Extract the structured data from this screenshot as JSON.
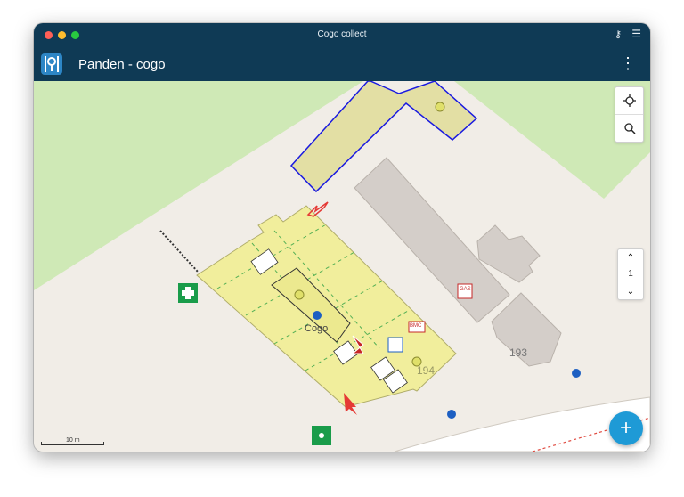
{
  "window": {
    "title": "Cogo collect"
  },
  "appbar": {
    "title": "Panden - cogo"
  },
  "icons": {
    "key": "key-icon",
    "hamburger": "hamburger-menu-icon",
    "more": "more-vertical-icon",
    "locate": "crosshair-locate-icon",
    "search": "search-icon",
    "zoom_up": "chevron-up-icon",
    "zoom_down": "chevron-down-icon",
    "add": "plus-icon"
  },
  "map": {
    "feature_labels": {
      "building": "Cogo",
      "number_194": "194",
      "number_193": "193"
    },
    "symbols": {
      "gas": "GAS",
      "bmc": "BMC"
    },
    "scale": "10 m"
  },
  "controls": {
    "level": "1"
  },
  "colors": {
    "bar": "#0f3a55",
    "fab": "#1e9ad6",
    "building": "#f1ee9c",
    "grass": "#cfe9b6",
    "outline": "#1a1ae0"
  }
}
